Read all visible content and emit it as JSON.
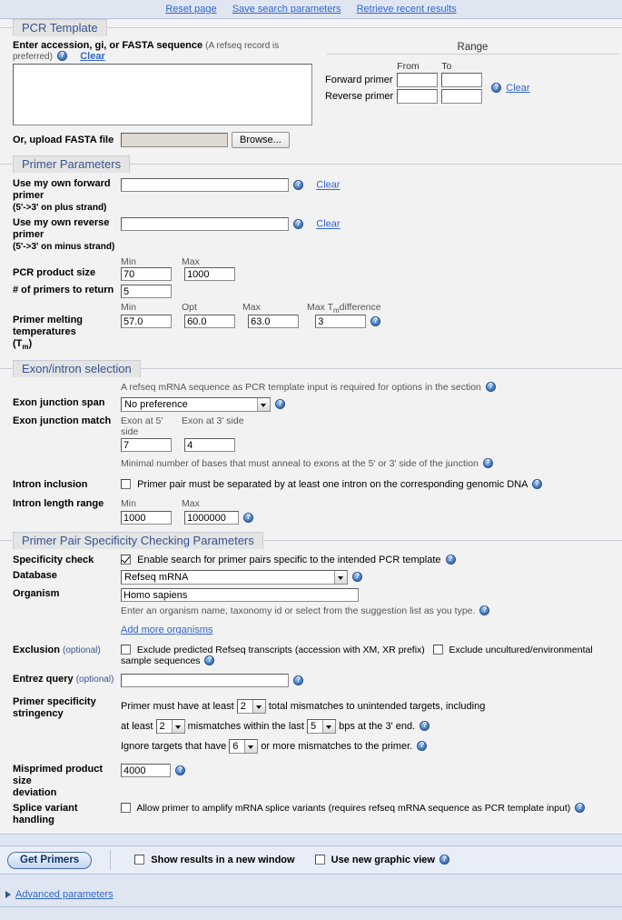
{
  "toplinks": [
    {
      "label": "Reset page"
    },
    {
      "label": "Save search parameters"
    },
    {
      "label": "Retrieve recent results"
    }
  ],
  "pcr_template": {
    "legend": "PCR Template",
    "seq_label": "Enter accession, gi, or FASTA sequence",
    "seq_hint": "(A refseq record is preferred)",
    "seq_clear": "Clear",
    "seq_value": "",
    "range_title": "Range",
    "col_from": "From",
    "col_to": "To",
    "row_forward": "Forward primer",
    "row_reverse": "Reverse primer",
    "fwd_from": "",
    "fwd_to": "",
    "rev_from": "",
    "rev_to": "",
    "range_clear": "Clear",
    "upload_label": "Or, upload FASTA file",
    "file_value": "",
    "browse_label": "Browse..."
  },
  "primer_parameters": {
    "legend": "Primer Parameters",
    "fwd_primer_label": "Use my own forward primer",
    "fwd_primer_sub": "(5'->3' on plus strand)",
    "fwd_primer_value": "",
    "fwd_clear": "Clear",
    "rev_primer_label": "Use my own reverse primer",
    "rev_primer_sub": "(5'->3' on minus strand)",
    "rev_primer_value": "",
    "rev_clear": "Clear",
    "product_size_label": "PCR product size",
    "cap_min": "Min",
    "cap_max": "Max",
    "product_min": "70",
    "product_max": "1000",
    "num_primers_label": "# of primers to return",
    "num_primers": "5",
    "tm_label": "Primer melting temperatures",
    "tm_label_sub": "(T",
    "tm_label_sub2": "m",
    "tm_label_sub3": ")",
    "cap_tm_min": "Min",
    "cap_tm_opt": "Opt",
    "cap_tm_max": "Max",
    "cap_tm_diff": "Max T",
    "cap_tm_diff_sub": "m",
    "cap_tm_diff_end": " difference",
    "tm_min": "57.0",
    "tm_opt": "60.0",
    "tm_max": "63.0",
    "tm_diff": "3"
  },
  "exon_intron": {
    "legend": "Exon/intron selection",
    "note": "A refseq mRNA sequence as PCR template input is required for options in the section",
    "junction_span_label": "Exon junction span",
    "junction_span_value": "No preference",
    "junction_match_label": "Exon junction match",
    "cap_exon5": "Exon at 5' side",
    "cap_exon3": "Exon at 3' side",
    "exon5_value": "7",
    "exon3_value": "4",
    "match_note": "Minimal number of bases that must anneal to exons at the 5' or 3' side of the junction",
    "intron_inclusion_label": "Intron inclusion",
    "intron_inclusion_text": "Primer pair must be separated by at least one intron on the corresponding genomic DNA",
    "intron_inclusion_checked": false,
    "intron_length_label": "Intron length range",
    "cap_min": "Min",
    "cap_max": "Max",
    "intron_min": "1000",
    "intron_max": "1000000"
  },
  "specificity": {
    "legend": "Primer Pair Specificity Checking Parameters",
    "spec_check_label": "Specificity check",
    "spec_check_text": "Enable search for primer pairs specific to the intended PCR template",
    "spec_check_checked": true,
    "database_label": "Database",
    "database_value": "Refseq mRNA",
    "organism_label": "Organism",
    "organism_value": "Homo sapiens",
    "organism_note": "Enter an organism name, taxonomy id or select from the suggestion list as you type.",
    "add_organisms": "Add more organisms",
    "exclusion_label": "Exclusion",
    "exclusion_opt": "(optional)",
    "exclude_predicted": "Exclude predicted Refseq transcripts (accession with XM, XR prefix)",
    "exclude_predicted_checked": false,
    "exclude_uncultured": "Exclude uncultured/environmental sample sequences",
    "exclude_uncultured_checked": false,
    "entrez_label": "Entrez query",
    "entrez_opt": "(optional)",
    "entrez_value": "",
    "stringency_label": "Primer specificity stringency",
    "stringency_l1a": "Primer must have at least",
    "stringency_v1": "2",
    "stringency_l1b": "total mismatches to unintended targets, including",
    "stringency_l2a": "at least",
    "stringency_v2": "2",
    "stringency_l2b": "mismatches within the last",
    "stringency_v3": "5",
    "stringency_l2c": "bps at the 3' end.",
    "stringency_l3a": "Ignore targets that have",
    "stringency_v4": "6",
    "stringency_l3b": "or more mismatches to the primer.",
    "mispriming_label": "Misprimed product size",
    "mispriming_label2": "deviation",
    "mispriming_value": "4000",
    "splice_label": "Splice variant handling",
    "splice_text": "Allow primer to amplify mRNA splice variants (requires refseq mRNA sequence as PCR template input)",
    "splice_checked": false
  },
  "submit": {
    "get_primers": "Get Primers",
    "new_window": "Show results in a new window",
    "new_window_checked": false,
    "graphic_view": "Use new graphic view",
    "graphic_view_checked": false,
    "advanced": "Advanced parameters"
  }
}
